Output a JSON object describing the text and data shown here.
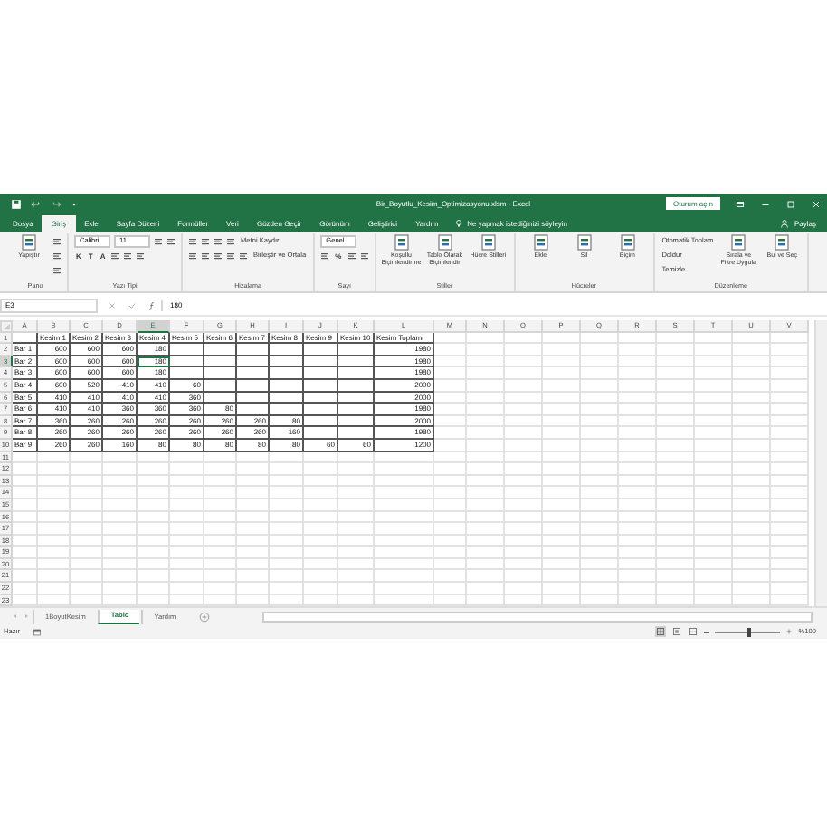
{
  "window": {
    "title": "Bir_Boyutlu_Kesim_Optimizasyonu.xlsm - Excel",
    "sign_in": "Oturum açın"
  },
  "tabs": [
    {
      "label": "Dosya",
      "selected": false
    },
    {
      "label": "Giriş",
      "selected": true
    },
    {
      "label": "Ekle",
      "selected": false
    },
    {
      "label": "Sayfa Düzeni",
      "selected": false
    },
    {
      "label": "Formüller",
      "selected": false
    },
    {
      "label": "Veri",
      "selected": false
    },
    {
      "label": "Gözden Geçir",
      "selected": false
    },
    {
      "label": "Görünüm",
      "selected": false
    },
    {
      "label": "Geliştirici",
      "selected": false
    },
    {
      "label": "Yardım",
      "selected": false
    }
  ],
  "search": {
    "placeholder": "Ne yapmak istediğinizi söyleyin"
  },
  "share": "Paylaş",
  "ribbon_groups": [
    {
      "label": "Pano",
      "items": [
        {
          "kind": "large",
          "label": "Yapıştır"
        },
        {
          "kind": "rows",
          "lines": [
            {
              "controls": [
                {
                  "kind": "icon"
                }
              ]
            },
            {
              "controls": [
                {
                  "kind": "icon"
                }
              ]
            },
            {
              "controls": [
                {
                  "kind": "icon"
                }
              ]
            }
          ]
        }
      ]
    },
    {
      "label": "Yazı Tipi",
      "items": [
        {
          "kind": "rows",
          "lines": [
            {
              "controls": [
                {
                  "kind": "dropdown",
                  "value": "Calibri"
                },
                {
                  "kind": "dropdown",
                  "value": "11"
                },
                {
                  "kind": "icon"
                },
                {
                  "kind": "icon"
                }
              ]
            },
            {
              "controls": [
                {
                  "kind": "text",
                  "label": "K"
                },
                {
                  "kind": "text",
                  "label": "T"
                },
                {
                  "kind": "text",
                  "label": "A"
                },
                {
                  "kind": "icon"
                },
                {
                  "kind": "icon"
                },
                {
                  "kind": "icon"
                }
              ]
            }
          ]
        }
      ]
    },
    {
      "label": "Hizalama",
      "items": [
        {
          "kind": "rows",
          "lines": [
            {
              "controls": [
                {
                  "kind": "icon"
                },
                {
                  "kind": "icon"
                },
                {
                  "kind": "icon"
                },
                {
                  "kind": "icon"
                },
                {
                  "kind": "small",
                  "label": "Metni Kaydır"
                }
              ]
            },
            {
              "controls": [
                {
                  "kind": "icon"
                },
                {
                  "kind": "icon"
                },
                {
                  "kind": "icon"
                },
                {
                  "kind": "icon"
                },
                {
                  "kind": "icon"
                },
                {
                  "kind": "small",
                  "label": "Birleştir ve Ortala"
                }
              ]
            }
          ]
        }
      ]
    },
    {
      "label": "Sayı",
      "items": [
        {
          "kind": "rows",
          "lines": [
            {
              "controls": [
                {
                  "kind": "dropdown",
                  "value": "Genel"
                }
              ]
            },
            {
              "controls": [
                {
                  "kind": "icon"
                },
                {
                  "kind": "text",
                  "label": "%"
                },
                {
                  "kind": "icon"
                },
                {
                  "kind": "icon"
                }
              ]
            }
          ]
        }
      ]
    },
    {
      "label": "Stiller",
      "items": [
        {
          "kind": "large",
          "label": "Koşullu Biçimlendirme"
        },
        {
          "kind": "large",
          "label": "Tablo Olarak Biçimlendir"
        },
        {
          "kind": "large",
          "label": "Hücre Stilleri"
        }
      ]
    },
    {
      "label": "Hücreler",
      "items": [
        {
          "kind": "large",
          "label": "Ekle"
        },
        {
          "kind": "large",
          "label": "Sil"
        },
        {
          "kind": "large",
          "label": "Biçim"
        }
      ]
    },
    {
      "label": "Düzenleme",
      "items": [
        {
          "kind": "rows",
          "lines": [
            {
              "controls": [
                {
                  "kind": "small",
                  "label": "Otomatik Toplam"
                }
              ]
            },
            {
              "controls": [
                {
                  "kind": "small",
                  "label": "Doldur"
                }
              ]
            },
            {
              "controls": [
                {
                  "kind": "small",
                  "label": "Temizle"
                }
              ]
            }
          ]
        },
        {
          "kind": "large",
          "label": "Sırala ve Filtre Uygula"
        },
        {
          "kind": "large",
          "label": "Bul ve Seç"
        }
      ]
    }
  ],
  "sheet": {
    "name_box": "E3",
    "formula": "180",
    "columns": [
      {
        "label": "A",
        "selected": false,
        "bordered": true
      },
      {
        "label": "B",
        "selected": false,
        "bordered": true
      },
      {
        "label": "C",
        "selected": false,
        "bordered": true
      },
      {
        "label": "D",
        "selected": false,
        "bordered": true
      },
      {
        "label": "E",
        "selected": true,
        "bordered": true
      },
      {
        "label": "F",
        "selected": false,
        "bordered": true
      },
      {
        "label": "G",
        "selected": false,
        "bordered": true
      },
      {
        "label": "H",
        "selected": false,
        "bordered": true
      },
      {
        "label": "I",
        "selected": false,
        "bordered": true
      },
      {
        "label": "J",
        "selected": false,
        "bordered": true
      },
      {
        "label": "K",
        "selected": false,
        "bordered": true
      },
      {
        "label": "L",
        "selected": false,
        "bordered": true
      },
      {
        "label": "M",
        "selected": false,
        "bordered": false
      },
      {
        "label": "N",
        "selected": false,
        "bordered": false
      },
      {
        "label": "O",
        "selected": false,
        "bordered": false
      },
      {
        "label": "P",
        "selected": false,
        "bordered": false
      },
      {
        "label": "Q",
        "selected": false,
        "bordered": false
      },
      {
        "label": "R",
        "selected": false,
        "bordered": false
      },
      {
        "label": "S",
        "selected": false,
        "bordered": false
      },
      {
        "label": "T",
        "selected": false,
        "bordered": false
      },
      {
        "label": "U",
        "selected": false,
        "bordered": false
      },
      {
        "label": "V",
        "selected": false,
        "bordered": false
      }
    ],
    "rows": [
      {
        "number": "1",
        "kind": "header",
        "selected": false,
        "bordered": true,
        "cells": {
          "B": "Kesim 1",
          "C": "Kesim 2",
          "D": "Kesim 3",
          "E": "Kesim 4",
          "F": "Kesim 5",
          "G": "Kesim 6",
          "H": "Kesim 7",
          "I": "Kesim 8",
          "J": "Kesim 9",
          "K": "Kesim 10",
          "L": "Kesim Toplamı"
        }
      },
      {
        "number": "2",
        "kind": "data",
        "selected": false,
        "bordered": true,
        "cells": {
          "A": "Bar 1",
          "B": "600",
          "C": "600",
          "D": "600",
          "E": "180",
          "L": "1980"
        }
      },
      {
        "number": "3",
        "kind": "data",
        "selected": true,
        "bordered": true,
        "cells": {
          "A": "Bar 2",
          "B": "600",
          "C": "600",
          "D": "600",
          "E": "180",
          "L": "1980"
        }
      },
      {
        "number": "4",
        "kind": "data",
        "selected": false,
        "bordered": true,
        "cells": {
          "A": "Bar 3",
          "B": "600",
          "C": "600",
          "D": "600",
          "E": "180",
          "L": "1980"
        }
      },
      {
        "number": "5",
        "kind": "data",
        "selected": false,
        "bordered": true,
        "cells": {
          "A": "Bar 4",
          "B": "600",
          "C": "520",
          "D": "410",
          "E": "410",
          "F": "60",
          "L": "2000"
        }
      },
      {
        "number": "6",
        "kind": "data",
        "selected": false,
        "bordered": true,
        "cells": {
          "A": "Bar 5",
          "B": "410",
          "C": "410",
          "D": "410",
          "E": "410",
          "F": "360",
          "L": "2000"
        }
      },
      {
        "number": "7",
        "kind": "data",
        "selected": false,
        "bordered": true,
        "cells": {
          "A": "Bar 6",
          "B": "410",
          "C": "410",
          "D": "360",
          "E": "360",
          "F": "360",
          "G": "80",
          "L": "1980"
        }
      },
      {
        "number": "8",
        "kind": "data",
        "selected": false,
        "bordered": true,
        "cells": {
          "A": "Bar 7",
          "B": "360",
          "C": "260",
          "D": "260",
          "E": "260",
          "F": "260",
          "G": "260",
          "H": "260",
          "I": "80",
          "L": "2000"
        }
      },
      {
        "number": "9",
        "kind": "data",
        "selected": false,
        "bordered": true,
        "cells": {
          "A": "Bar 8",
          "B": "260",
          "C": "260",
          "D": "260",
          "E": "260",
          "F": "260",
          "G": "260",
          "H": "260",
          "I": "160",
          "L": "1980"
        }
      },
      {
        "number": "10",
        "kind": "data",
        "selected": false,
        "bordered": true,
        "cells": {
          "A": "Bar 9",
          "B": "260",
          "C": "260",
          "D": "160",
          "E": "80",
          "F": "80",
          "G": "80",
          "H": "80",
          "I": "80",
          "J": "60",
          "K": "60",
          "L": "1200"
        }
      },
      {
        "number": "11",
        "kind": "data",
        "selected": false,
        "bordered": false
      },
      {
        "number": "12",
        "kind": "data",
        "selected": false,
        "bordered": false
      },
      {
        "number": "13",
        "kind": "data",
        "selected": false,
        "bordered": false
      },
      {
        "number": "14",
        "kind": "data",
        "selected": false,
        "bordered": false
      },
      {
        "number": "15",
        "kind": "data",
        "selected": false,
        "bordered": false
      },
      {
        "number": "16",
        "kind": "data",
        "selected": false,
        "bordered": false
      },
      {
        "number": "17",
        "kind": "data",
        "selected": false,
        "bordered": false
      },
      {
        "number": "18",
        "kind": "data",
        "selected": false,
        "bordered": false
      },
      {
        "number": "19",
        "kind": "data",
        "selected": false,
        "bordered": false
      },
      {
        "number": "20",
        "kind": "data",
        "selected": false,
        "bordered": false
      },
      {
        "number": "21",
        "kind": "data",
        "selected": false,
        "bordered": false
      },
      {
        "number": "22",
        "kind": "data",
        "selected": false,
        "bordered": false
      },
      {
        "number": "23",
        "kind": "data",
        "selected": false,
        "bordered": false
      }
    ]
  },
  "sheet_tabs": [
    {
      "label": "1BoyutKesim",
      "selected": false
    },
    {
      "label": "Tablo",
      "selected": true
    },
    {
      "label": "Yardım",
      "selected": false
    }
  ],
  "status": {
    "text": "Hazır",
    "zoom_label": "%100",
    "zoom": {
      "level": 0.5
    }
  }
}
